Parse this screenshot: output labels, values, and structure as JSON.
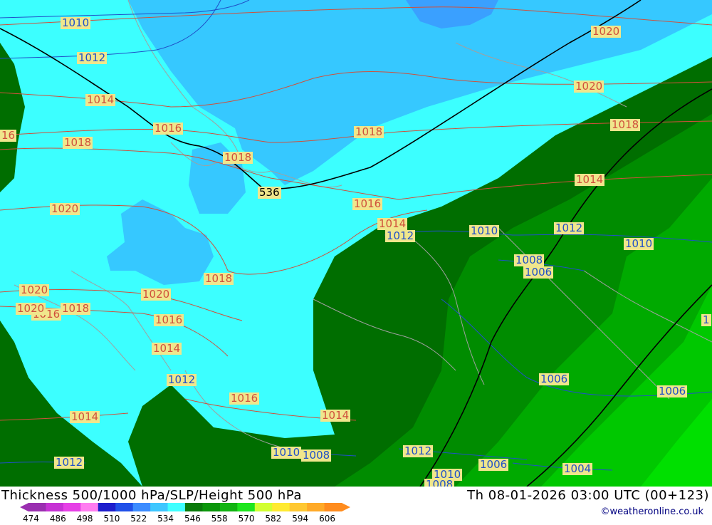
{
  "header": {
    "title": "Thickness 500/1000 hPa/SLP/Height 500 hPa",
    "valid_time": "Th 08-01-2026 03:00 UTC (00+123)"
  },
  "credit": "©weatheronline.co.uk",
  "legend": {
    "ticks": [
      "474",
      "486",
      "498",
      "510",
      "522",
      "534",
      "546",
      "558",
      "570",
      "582",
      "594",
      "606"
    ],
    "colors": [
      "#9a2fb0",
      "#c632d4",
      "#e640e6",
      "#ff7df0",
      "#1e1ecc",
      "#2050e8",
      "#3c8cff",
      "#3ec7ff",
      "#40ffff",
      "#0a7a0a",
      "#0a960a",
      "#12b412",
      "#1ee61e",
      "#d2ff32",
      "#ffea32",
      "#ffc832",
      "#ffaa28",
      "#ff8c1e"
    ]
  },
  "map": {
    "colors": {
      "dark_blue": "#3aa0ff",
      "medium_blue": "#36c8ff",
      "cyan": "#3cffff",
      "dark_green": "#006e00",
      "green": "#008c00",
      "mid_green": "#00aa00",
      "light_green": "#00c800",
      "bright_green": "#00e000",
      "isobar_red": "#d0503c",
      "isobar_blue": "#2050c8",
      "label_bg": "#f0e68c"
    },
    "labels": [
      {
        "id": "l1",
        "text": "1010",
        "kind": "blue"
      },
      {
        "id": "l2",
        "text": "1012",
        "kind": "blue"
      },
      {
        "id": "l3",
        "text": "1014",
        "kind": "red"
      },
      {
        "id": "l4",
        "text": "1016",
        "kind": "red"
      },
      {
        "id": "l5",
        "text": "16",
        "kind": "red"
      },
      {
        "id": "l6",
        "text": "1018",
        "kind": "red"
      },
      {
        "id": "l7",
        "text": "1018",
        "kind": "red"
      },
      {
        "id": "l8",
        "text": "536",
        "kind": "black"
      },
      {
        "id": "l9",
        "text": "1018",
        "kind": "red"
      },
      {
        "id": "l10",
        "text": "1020",
        "kind": "red"
      },
      {
        "id": "l11",
        "text": "1020",
        "kind": "red"
      },
      {
        "id": "l12",
        "text": "1018",
        "kind": "red"
      },
      {
        "id": "l13",
        "text": "1016",
        "kind": "red"
      },
      {
        "id": "l14",
        "text": "1014",
        "kind": "red"
      },
      {
        "id": "l15",
        "text": "1012",
        "kind": "blue"
      },
      {
        "id": "l16",
        "text": "1010",
        "kind": "blue"
      },
      {
        "id": "l17",
        "text": "1012",
        "kind": "blue"
      },
      {
        "id": "l18",
        "text": "1010",
        "kind": "blue"
      },
      {
        "id": "l19",
        "text": "1008",
        "kind": "blue"
      },
      {
        "id": "l20",
        "text": "1006",
        "kind": "blue"
      },
      {
        "id": "l21",
        "text": "1014",
        "kind": "red"
      },
      {
        "id": "l22",
        "text": "1016",
        "kind": "red"
      },
      {
        "id": "l23",
        "text": "1018",
        "kind": "red"
      },
      {
        "id": "l24",
        "text": "1020",
        "kind": "red"
      },
      {
        "id": "l25",
        "text": "1020",
        "kind": "red"
      },
      {
        "id": "l26",
        "text": "1020",
        "kind": "red"
      },
      {
        "id": "l27",
        "text": "1016",
        "kind": "red"
      },
      {
        "id": "l28",
        "text": "1018",
        "kind": "red"
      },
      {
        "id": "l29",
        "text": "1020",
        "kind": "red"
      },
      {
        "id": "l30",
        "text": "1016",
        "kind": "red"
      },
      {
        "id": "l31",
        "text": "1014",
        "kind": "red"
      },
      {
        "id": "l32",
        "text": "1012",
        "kind": "blue"
      },
      {
        "id": "l33",
        "text": "1016",
        "kind": "red"
      },
      {
        "id": "l34",
        "text": "1014",
        "kind": "red"
      },
      {
        "id": "l35",
        "text": "1014",
        "kind": "red"
      },
      {
        "id": "l36",
        "text": "1012",
        "kind": "blue"
      },
      {
        "id": "l37",
        "text": "1010",
        "kind": "blue"
      },
      {
        "id": "l38",
        "text": "1008",
        "kind": "blue"
      },
      {
        "id": "l39",
        "text": "1012",
        "kind": "blue"
      },
      {
        "id": "l40",
        "text": "1010",
        "kind": "blue"
      },
      {
        "id": "l41",
        "text": "1006",
        "kind": "blue"
      },
      {
        "id": "l42",
        "text": "1006",
        "kind": "blue"
      },
      {
        "id": "l43",
        "text": "1006",
        "kind": "blue"
      },
      {
        "id": "l44",
        "text": "1004",
        "kind": "blue"
      },
      {
        "id": "l45",
        "text": "1008",
        "kind": "blue"
      },
      {
        "id": "l46",
        "text": "1",
        "kind": "blue"
      }
    ]
  }
}
